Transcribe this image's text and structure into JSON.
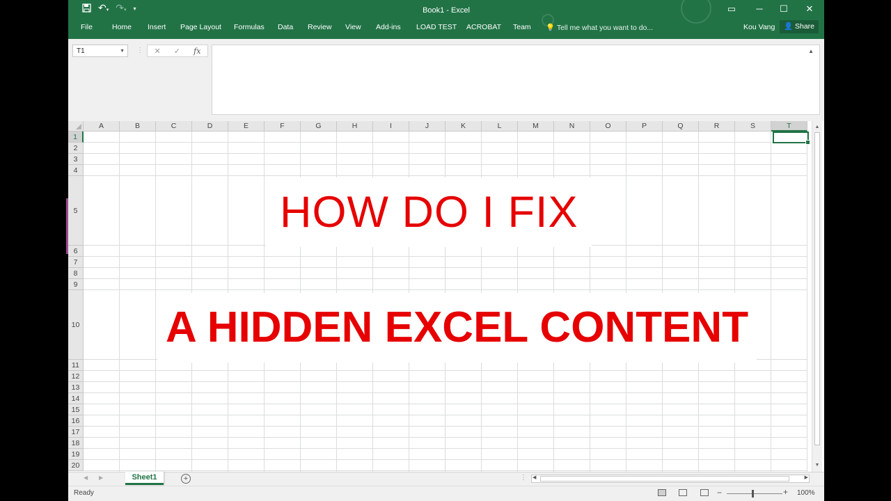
{
  "window": {
    "title": "Book1 - Excel"
  },
  "qat": {
    "save_icon": "save-icon",
    "undo_icon": "undo-icon",
    "redo_icon": "redo-icon"
  },
  "ribbon": {
    "tabs": [
      "File",
      "Home",
      "Insert",
      "Page Layout",
      "Formulas",
      "Data",
      "Review",
      "View",
      "Add-ins",
      "LOAD TEST",
      "ACROBAT",
      "Team"
    ],
    "tell_me": "Tell me what you want to do...",
    "user": "Kou Vang",
    "share": "Share"
  },
  "formula_bar": {
    "name_box": "T1",
    "fx": "fx",
    "value": ""
  },
  "grid": {
    "columns": [
      "A",
      "B",
      "C",
      "D",
      "E",
      "F",
      "G",
      "H",
      "I",
      "J",
      "K",
      "L",
      "M",
      "N",
      "O",
      "P",
      "Q",
      "R",
      "S",
      "T"
    ],
    "selected_column": "T",
    "rows": [
      "1",
      "2",
      "3",
      "4",
      "5",
      "6",
      "7",
      "8",
      "9",
      "10",
      "11",
      "12",
      "13",
      "14",
      "15",
      "16",
      "17",
      "18",
      "19",
      "20"
    ],
    "selected_row": "1",
    "cell_e5": "HOW DO I FIX",
    "cell_c10": "A HIDDEN EXCEL CONTENT"
  },
  "sheets": {
    "active": "Sheet1"
  },
  "status": {
    "text": "Ready",
    "zoom": "100%"
  },
  "colors": {
    "accent": "#217346",
    "text_red": "#e60000"
  }
}
